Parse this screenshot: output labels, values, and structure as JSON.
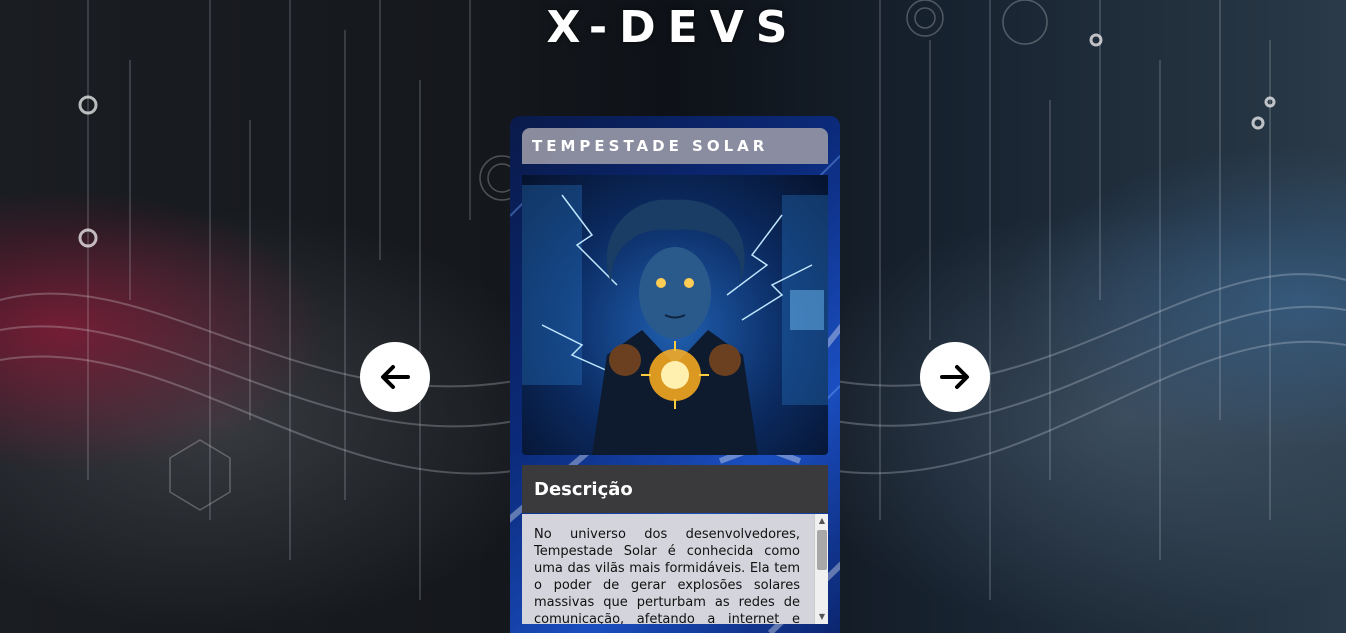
{
  "site": {
    "title": "X-DEVS"
  },
  "nav": {
    "prev_icon": "arrow-left-icon",
    "next_icon": "arrow-right-icon"
  },
  "card": {
    "title": "TEMPESTADE SOLAR",
    "description_heading": "Descrição",
    "description": "No universo dos desenvolvedores, Tempestade Solar é conhecida como uma das vilãs mais formidáveis. Ela tem o poder de gerar explosões solares massivas que perturbam as redes de comunicação, afetando a internet e todos os dispositivos"
  },
  "colors": {
    "accent": "#1a4ec0",
    "title_bar": "#9696a5",
    "desc_header": "#3a3a3c",
    "desc_box": "#d4d4dc"
  }
}
